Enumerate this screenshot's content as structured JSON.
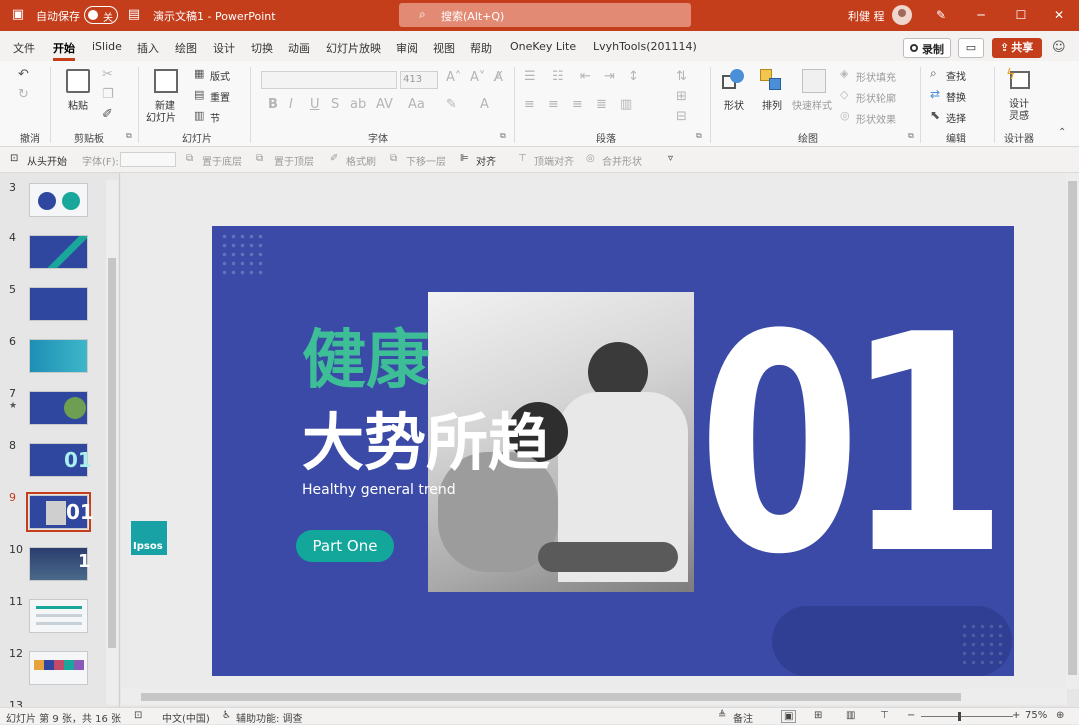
{
  "titlebar": {
    "autosave_label": "自动保存",
    "autosave_state": "关",
    "doc_title": "演示文稿1  -  PowerPoint",
    "search_placeholder": "搜索(Alt+Q)",
    "user_name": "利健 程",
    "accent_color": "#c43e1c"
  },
  "menu": {
    "tabs": [
      "文件",
      "开始",
      "iSlide",
      "插入",
      "绘图",
      "设计",
      "切换",
      "动画",
      "幻灯片放映",
      "审阅",
      "视图",
      "帮助",
      "OneKey Lite",
      "LvyhTools(201114)"
    ],
    "active_tab": "开始",
    "record_label": "录制",
    "share_label": "共享"
  },
  "ribbon": {
    "groups": {
      "undo": "撤消",
      "clipboard": "剪贴板",
      "slides": "幻灯片",
      "font": "字体",
      "paragraph": "段落",
      "drawing": "绘图",
      "editing": "编辑",
      "designer": "设计器"
    },
    "paste": "粘贴",
    "new_slide_1": "新建",
    "new_slide_2": "幻灯片",
    "layout": "版式",
    "reset": "重置",
    "section": "节",
    "font_size": "413",
    "shape": "形状",
    "arrange": "排列",
    "quick_styles": "快速样式",
    "shape_fill": "形状填充",
    "shape_outline": "形状轮廓",
    "shape_effects": "形状效果",
    "find": "查找",
    "replace": "替换",
    "select": "选择",
    "design_ideas_1": "设计",
    "design_ideas_2": "灵感"
  },
  "quicktoolbar": {
    "from_start": "从头开始",
    "font_label": "字体(F):",
    "bring_back": "置于底层",
    "bring_front": "置于顶层",
    "format_painter": "格式刷",
    "move_down": "下移一层",
    "align": "对齐",
    "top_align": "顶端对齐",
    "merge_shapes": "合并形状"
  },
  "thumbnails": {
    "numbers": [
      "3",
      "4",
      "5",
      "6",
      "7",
      "8",
      "9",
      "10",
      "11",
      "12",
      "13"
    ],
    "selected": "9",
    "star": "★",
    "t8_digits": "01",
    "t9_digits": "01",
    "t10_digit": "1"
  },
  "slide": {
    "title_green": "健康",
    "title_white": "大势所趋",
    "subtitle": "Healthy general trend",
    "button": "Part One",
    "big_number": "01",
    "logo": "Ipsos",
    "bg_color": "#3a4aa6",
    "green_color": "#3dbe96",
    "teal_color": "#13a79b"
  },
  "statusbar": {
    "slide_info": "幻灯片 第 9 张，共 16 张",
    "language": "中文(中国)",
    "accessibility": "辅助功能: 调查",
    "notes": "备注",
    "zoom": "75%"
  }
}
